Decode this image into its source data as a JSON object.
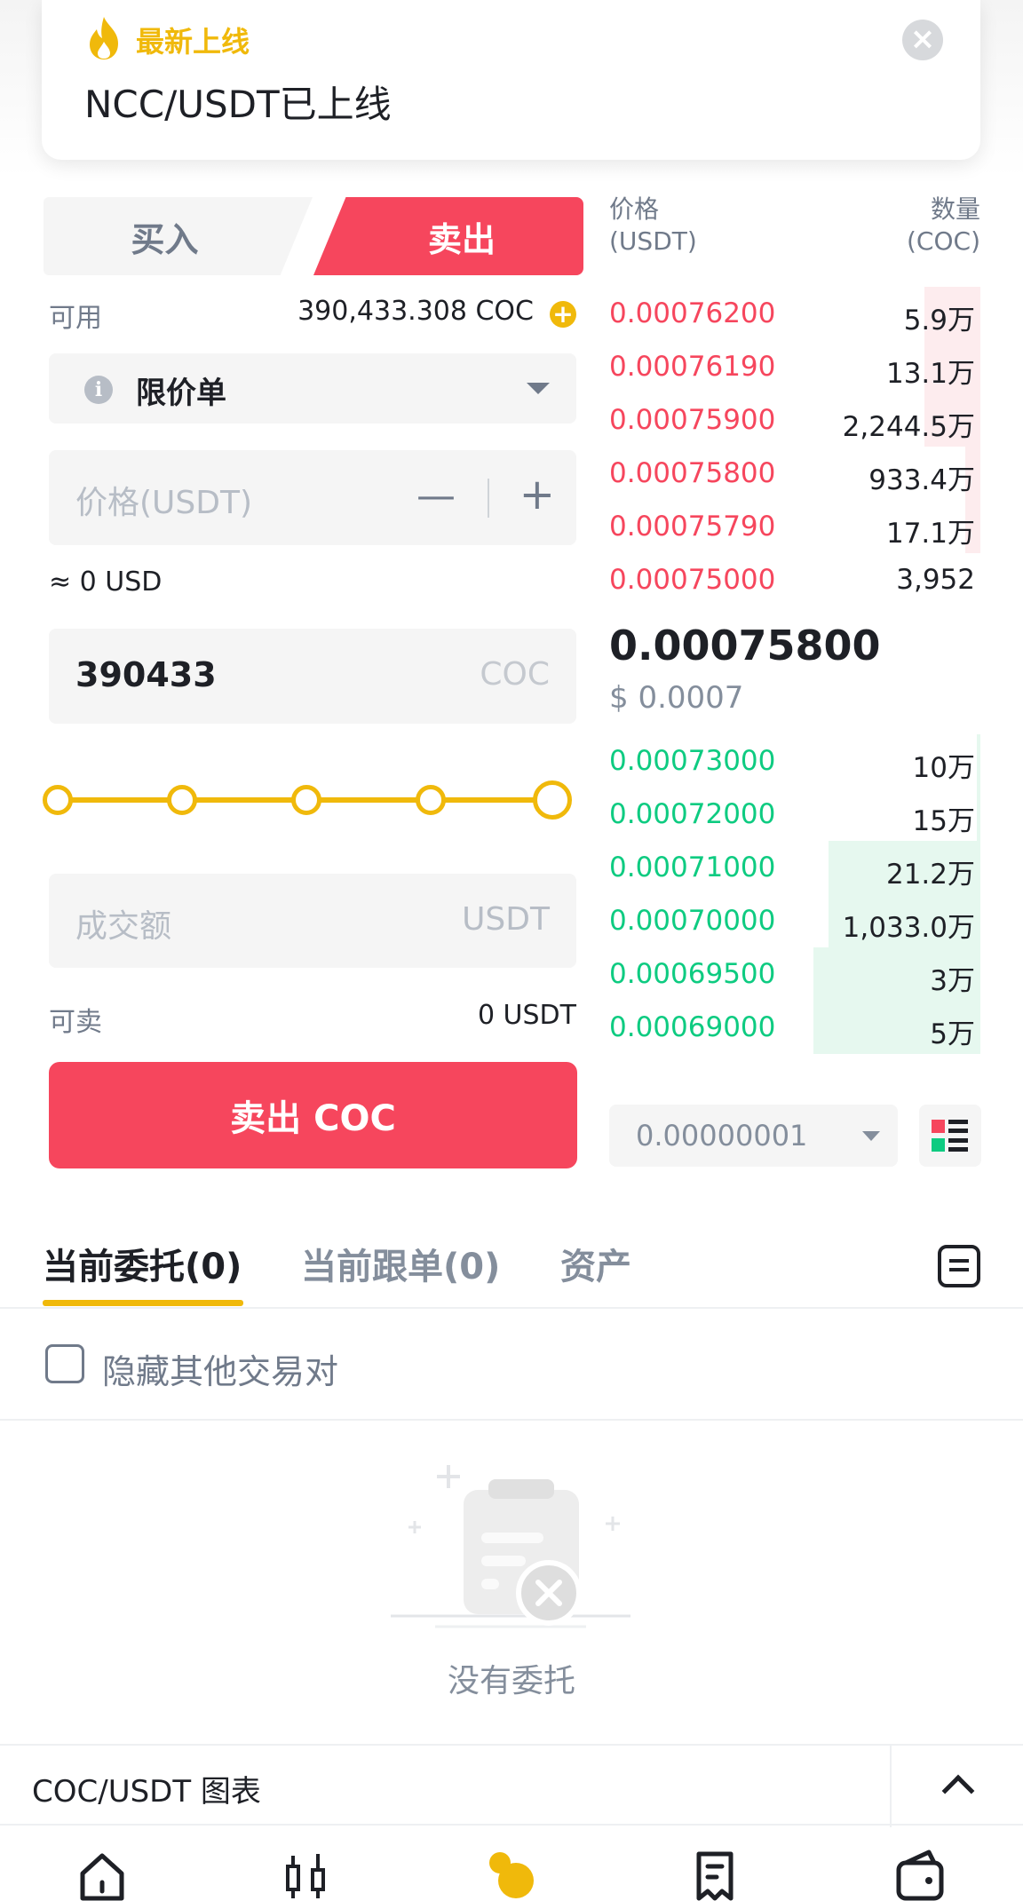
{
  "banner": {
    "title": "最新上线",
    "message": "NCC/USDT已上线"
  },
  "trade": {
    "buy_tab": "买入",
    "sell_tab": "卖出",
    "available_label": "可用",
    "available_value": "390,433.308 COC",
    "order_type": "限价单",
    "price_placeholder": "价格(USDT)",
    "approx_usd": "≈ 0 USD",
    "amount_value": "390433",
    "amount_unit": "COC",
    "slider_percent": 100,
    "total_placeholder": "成交额",
    "total_unit": "USDT",
    "sellable_label": "可卖",
    "sellable_value": "0 USDT",
    "sell_button": "卖出 COC"
  },
  "orderbook": {
    "price_header": "价格",
    "price_unit": "(USDT)",
    "qty_header": "数量",
    "qty_unit": "(COC)",
    "asks": [
      {
        "price": "0.00076200",
        "qty": "5.9万",
        "depth": 0.15
      },
      {
        "price": "0.00076190",
        "qty": "13.1万",
        "depth": 0.15
      },
      {
        "price": "0.00075900",
        "qty": "2,244.5万",
        "depth": 0.15
      },
      {
        "price": "0.00075800",
        "qty": "933.4万",
        "depth": 0.04
      },
      {
        "price": "0.00075790",
        "qty": "17.1万",
        "depth": 0.04
      },
      {
        "price": "0.00075000",
        "qty": "3,952",
        "depth": 0
      }
    ],
    "last_price": "0.00075800",
    "last_price_usd": "$ 0.0007",
    "bids": [
      {
        "price": "0.00073000",
        "qty": "10万",
        "depth": 0.01
      },
      {
        "price": "0.00072000",
        "qty": "15万",
        "depth": 0.01
      },
      {
        "price": "0.00071000",
        "qty": "21.2万",
        "depth": 0.41
      },
      {
        "price": "0.00070000",
        "qty": "1,033.0万",
        "depth": 0.41
      },
      {
        "price": "0.00069500",
        "qty": "3万",
        "depth": 0.45
      },
      {
        "price": "0.00069000",
        "qty": "5万",
        "depth": 0.45
      }
    ],
    "precision": "0.00000001"
  },
  "orders": {
    "tabs": [
      "当前委托(0)",
      "当前跟单(0)",
      "资产"
    ],
    "hide_other_pairs": "隐藏其他交易对",
    "empty_text": "没有委托"
  },
  "chart_bar": {
    "label": "COC/USDT 图表"
  },
  "colors": {
    "sell": "#f6465d",
    "buy": "#0ecb81",
    "accent": "#f0b90b"
  },
  "bottom_nav": [
    "home-icon",
    "markets-candle-icon",
    "trade-icon",
    "futures-icon",
    "wallet-icon"
  ]
}
